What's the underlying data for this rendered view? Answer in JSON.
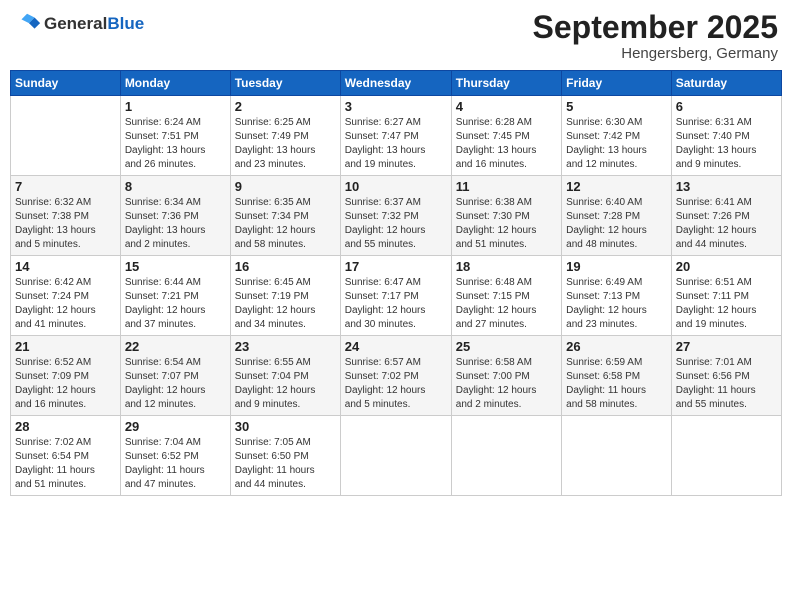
{
  "header": {
    "logo_general": "General",
    "logo_blue": "Blue",
    "month_title": "September 2025",
    "location": "Hengersberg, Germany"
  },
  "days_of_week": [
    "Sunday",
    "Monday",
    "Tuesday",
    "Wednesday",
    "Thursday",
    "Friday",
    "Saturday"
  ],
  "weeks": [
    [
      {
        "day": "",
        "info": ""
      },
      {
        "day": "1",
        "info": "Sunrise: 6:24 AM\nSunset: 7:51 PM\nDaylight: 13 hours\nand 26 minutes."
      },
      {
        "day": "2",
        "info": "Sunrise: 6:25 AM\nSunset: 7:49 PM\nDaylight: 13 hours\nand 23 minutes."
      },
      {
        "day": "3",
        "info": "Sunrise: 6:27 AM\nSunset: 7:47 PM\nDaylight: 13 hours\nand 19 minutes."
      },
      {
        "day": "4",
        "info": "Sunrise: 6:28 AM\nSunset: 7:45 PM\nDaylight: 13 hours\nand 16 minutes."
      },
      {
        "day": "5",
        "info": "Sunrise: 6:30 AM\nSunset: 7:42 PM\nDaylight: 13 hours\nand 12 minutes."
      },
      {
        "day": "6",
        "info": "Sunrise: 6:31 AM\nSunset: 7:40 PM\nDaylight: 13 hours\nand 9 minutes."
      }
    ],
    [
      {
        "day": "7",
        "info": "Sunrise: 6:32 AM\nSunset: 7:38 PM\nDaylight: 13 hours\nand 5 minutes."
      },
      {
        "day": "8",
        "info": "Sunrise: 6:34 AM\nSunset: 7:36 PM\nDaylight: 13 hours\nand 2 minutes."
      },
      {
        "day": "9",
        "info": "Sunrise: 6:35 AM\nSunset: 7:34 PM\nDaylight: 12 hours\nand 58 minutes."
      },
      {
        "day": "10",
        "info": "Sunrise: 6:37 AM\nSunset: 7:32 PM\nDaylight: 12 hours\nand 55 minutes."
      },
      {
        "day": "11",
        "info": "Sunrise: 6:38 AM\nSunset: 7:30 PM\nDaylight: 12 hours\nand 51 minutes."
      },
      {
        "day": "12",
        "info": "Sunrise: 6:40 AM\nSunset: 7:28 PM\nDaylight: 12 hours\nand 48 minutes."
      },
      {
        "day": "13",
        "info": "Sunrise: 6:41 AM\nSunset: 7:26 PM\nDaylight: 12 hours\nand 44 minutes."
      }
    ],
    [
      {
        "day": "14",
        "info": "Sunrise: 6:42 AM\nSunset: 7:24 PM\nDaylight: 12 hours\nand 41 minutes."
      },
      {
        "day": "15",
        "info": "Sunrise: 6:44 AM\nSunset: 7:21 PM\nDaylight: 12 hours\nand 37 minutes."
      },
      {
        "day": "16",
        "info": "Sunrise: 6:45 AM\nSunset: 7:19 PM\nDaylight: 12 hours\nand 34 minutes."
      },
      {
        "day": "17",
        "info": "Sunrise: 6:47 AM\nSunset: 7:17 PM\nDaylight: 12 hours\nand 30 minutes."
      },
      {
        "day": "18",
        "info": "Sunrise: 6:48 AM\nSunset: 7:15 PM\nDaylight: 12 hours\nand 27 minutes."
      },
      {
        "day": "19",
        "info": "Sunrise: 6:49 AM\nSunset: 7:13 PM\nDaylight: 12 hours\nand 23 minutes."
      },
      {
        "day": "20",
        "info": "Sunrise: 6:51 AM\nSunset: 7:11 PM\nDaylight: 12 hours\nand 19 minutes."
      }
    ],
    [
      {
        "day": "21",
        "info": "Sunrise: 6:52 AM\nSunset: 7:09 PM\nDaylight: 12 hours\nand 16 minutes."
      },
      {
        "day": "22",
        "info": "Sunrise: 6:54 AM\nSunset: 7:07 PM\nDaylight: 12 hours\nand 12 minutes."
      },
      {
        "day": "23",
        "info": "Sunrise: 6:55 AM\nSunset: 7:04 PM\nDaylight: 12 hours\nand 9 minutes."
      },
      {
        "day": "24",
        "info": "Sunrise: 6:57 AM\nSunset: 7:02 PM\nDaylight: 12 hours\nand 5 minutes."
      },
      {
        "day": "25",
        "info": "Sunrise: 6:58 AM\nSunset: 7:00 PM\nDaylight: 12 hours\nand 2 minutes."
      },
      {
        "day": "26",
        "info": "Sunrise: 6:59 AM\nSunset: 6:58 PM\nDaylight: 11 hours\nand 58 minutes."
      },
      {
        "day": "27",
        "info": "Sunrise: 7:01 AM\nSunset: 6:56 PM\nDaylight: 11 hours\nand 55 minutes."
      }
    ],
    [
      {
        "day": "28",
        "info": "Sunrise: 7:02 AM\nSunset: 6:54 PM\nDaylight: 11 hours\nand 51 minutes."
      },
      {
        "day": "29",
        "info": "Sunrise: 7:04 AM\nSunset: 6:52 PM\nDaylight: 11 hours\nand 47 minutes."
      },
      {
        "day": "30",
        "info": "Sunrise: 7:05 AM\nSunset: 6:50 PM\nDaylight: 11 hours\nand 44 minutes."
      },
      {
        "day": "",
        "info": ""
      },
      {
        "day": "",
        "info": ""
      },
      {
        "day": "",
        "info": ""
      },
      {
        "day": "",
        "info": ""
      }
    ]
  ]
}
